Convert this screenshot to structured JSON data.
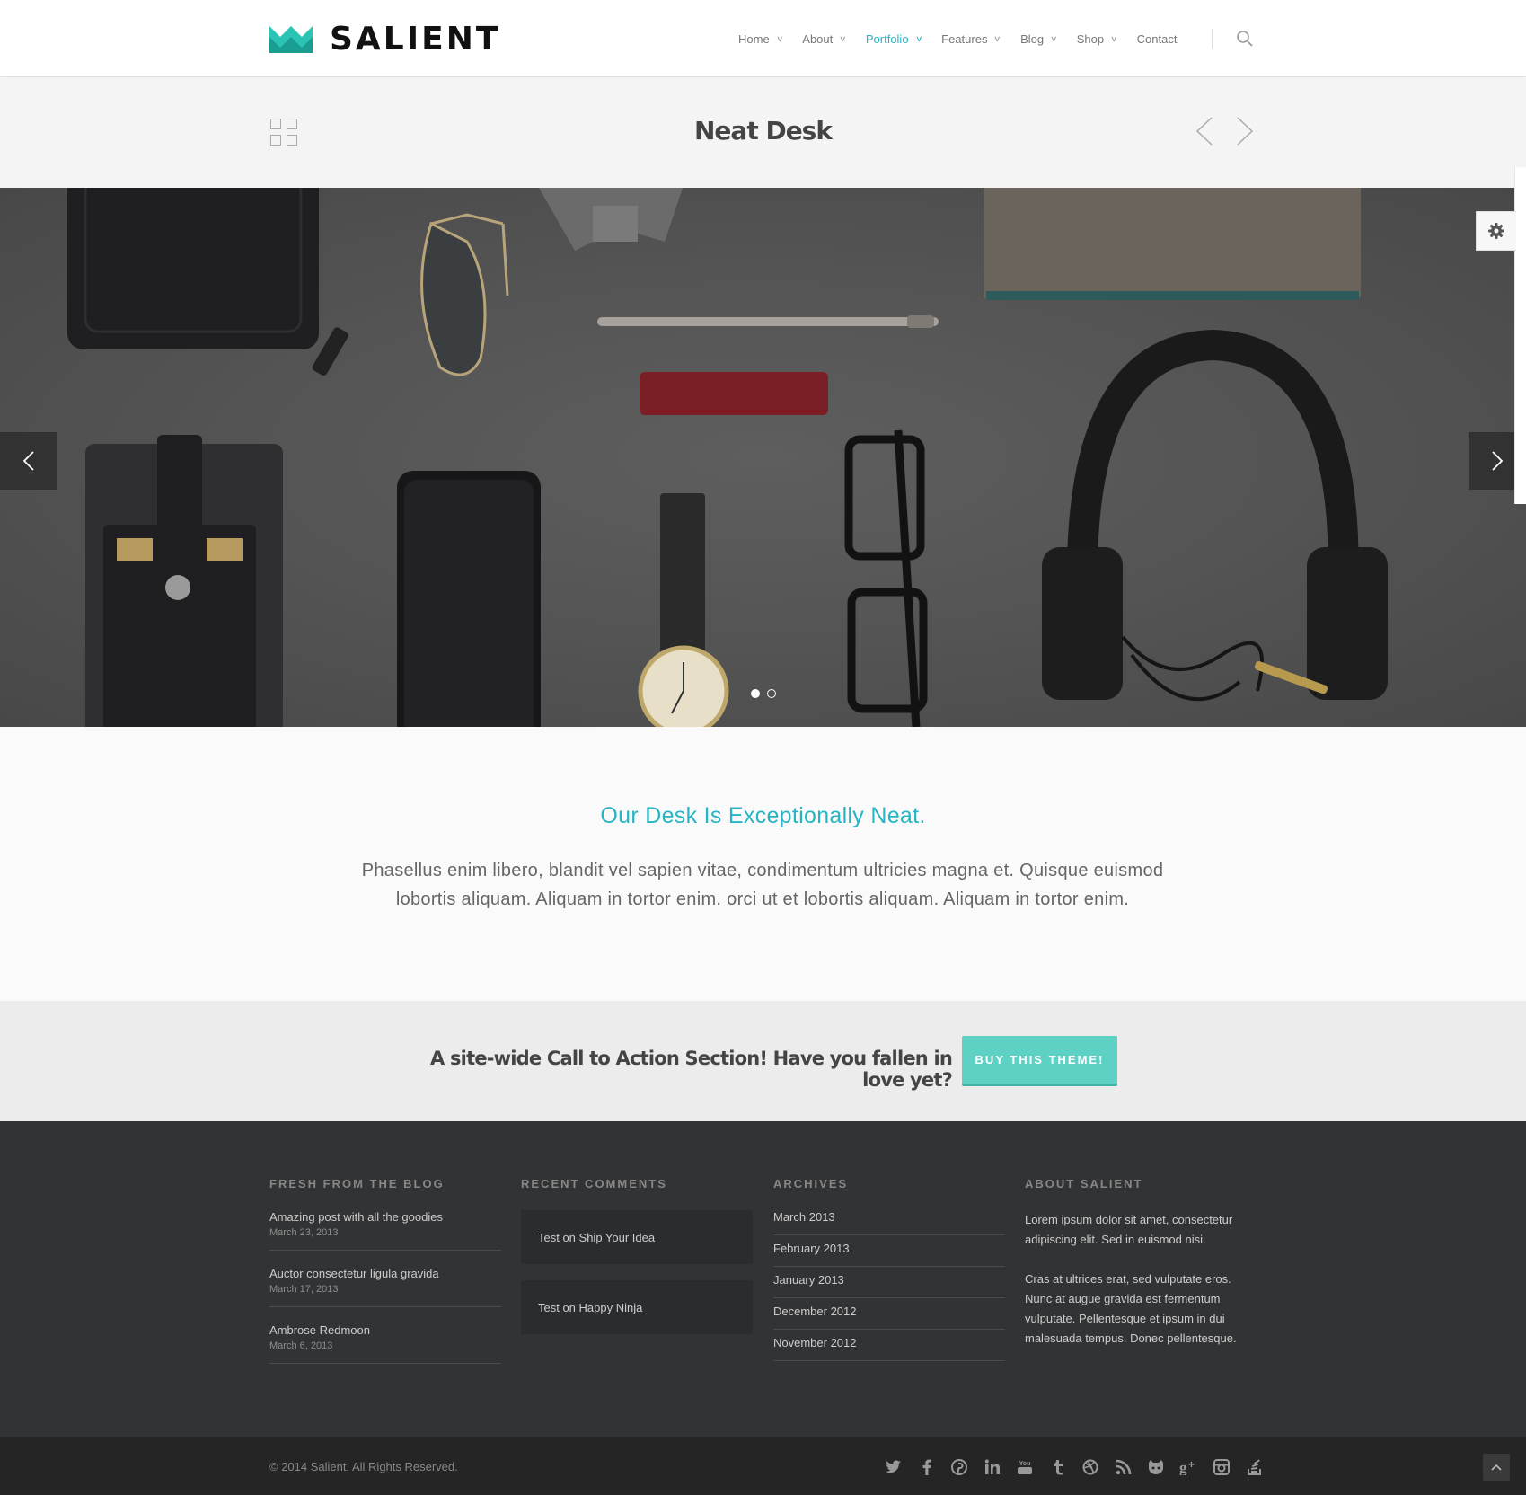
{
  "brand": {
    "name": "SALIENT",
    "accent": "#27b4c4",
    "logo_color": "#2bc4b4"
  },
  "nav": {
    "items": [
      {
        "label": "Home",
        "has_dropdown": true,
        "active": false
      },
      {
        "label": "About",
        "has_dropdown": true,
        "active": false
      },
      {
        "label": "Portfolio",
        "has_dropdown": true,
        "active": true
      },
      {
        "label": "Features",
        "has_dropdown": true,
        "active": false
      },
      {
        "label": "Blog",
        "has_dropdown": true,
        "active": false
      },
      {
        "label": "Shop",
        "has_dropdown": true,
        "active": false
      },
      {
        "label": "Contact",
        "has_dropdown": false,
        "active": false
      }
    ],
    "search_icon": "search-icon"
  },
  "project": {
    "title": "Neat Desk",
    "back_icon": "grid-icon",
    "prev_icon": "arrow-left-icon",
    "next_icon": "arrow-right-icon"
  },
  "slider": {
    "image_subject": "flat lay of desk items",
    "slide_count": 2,
    "active_slide": 1
  },
  "intro": {
    "heading": "Our Desk Is Exceptionally Neat.",
    "body": "Phasellus enim libero, blandit vel sapien vitae, condimentum ultricies magna et. Quisque euismod lobortis aliquam. Aliquam in tortor enim. orci ut et lobortis aliquam. Aliquam in tortor enim."
  },
  "cta": {
    "text": "A site-wide Call to Action Section! Have you fallen in love yet?",
    "button": "BUY THIS THEME!",
    "button_color": "#5dd1c4"
  },
  "footer": {
    "blog": {
      "heading": "FRESH FROM THE BLOG",
      "items": [
        {
          "title": "Amazing post with all the goodies",
          "date": "March 23, 2013"
        },
        {
          "title": "Auctor consectetur ligula gravida",
          "date": "March 17, 2013"
        },
        {
          "title": "Ambrose Redmoon",
          "date": "March 6, 2013"
        }
      ]
    },
    "comments": {
      "heading": "RECENT COMMENTS",
      "items": [
        "Test on Ship Your Idea",
        "Test on Happy Ninja"
      ]
    },
    "archives": {
      "heading": "ARCHIVES",
      "items": [
        "March 2013",
        "February 2013",
        "January 2013",
        "December 2012",
        "November 2012"
      ]
    },
    "about": {
      "heading": "ABOUT SALIENT",
      "p1": "Lorem ipsum dolor sit amet, consectetur adipiscing elit. Sed in euismod nisi.",
      "p2": "Cras at ultrices erat, sed vulputate eros. Nunc at augue gravida est fermentum vulputate. Pellentesque et ipsum in dui malesuada tempus. Donec pellentesque."
    }
  },
  "bottom": {
    "copyright": "© 2014 Salient. All Rights Reserved.",
    "socials": [
      "twitter-icon",
      "facebook-icon",
      "pinterest-icon",
      "linkedin-icon",
      "youtube-icon",
      "tumblr-icon",
      "dribbble-icon",
      "rss-icon",
      "github-icon",
      "google-plus-icon",
      "instagram-icon",
      "stackexchange-icon"
    ],
    "to_top_icon": "chevron-up-icon"
  }
}
